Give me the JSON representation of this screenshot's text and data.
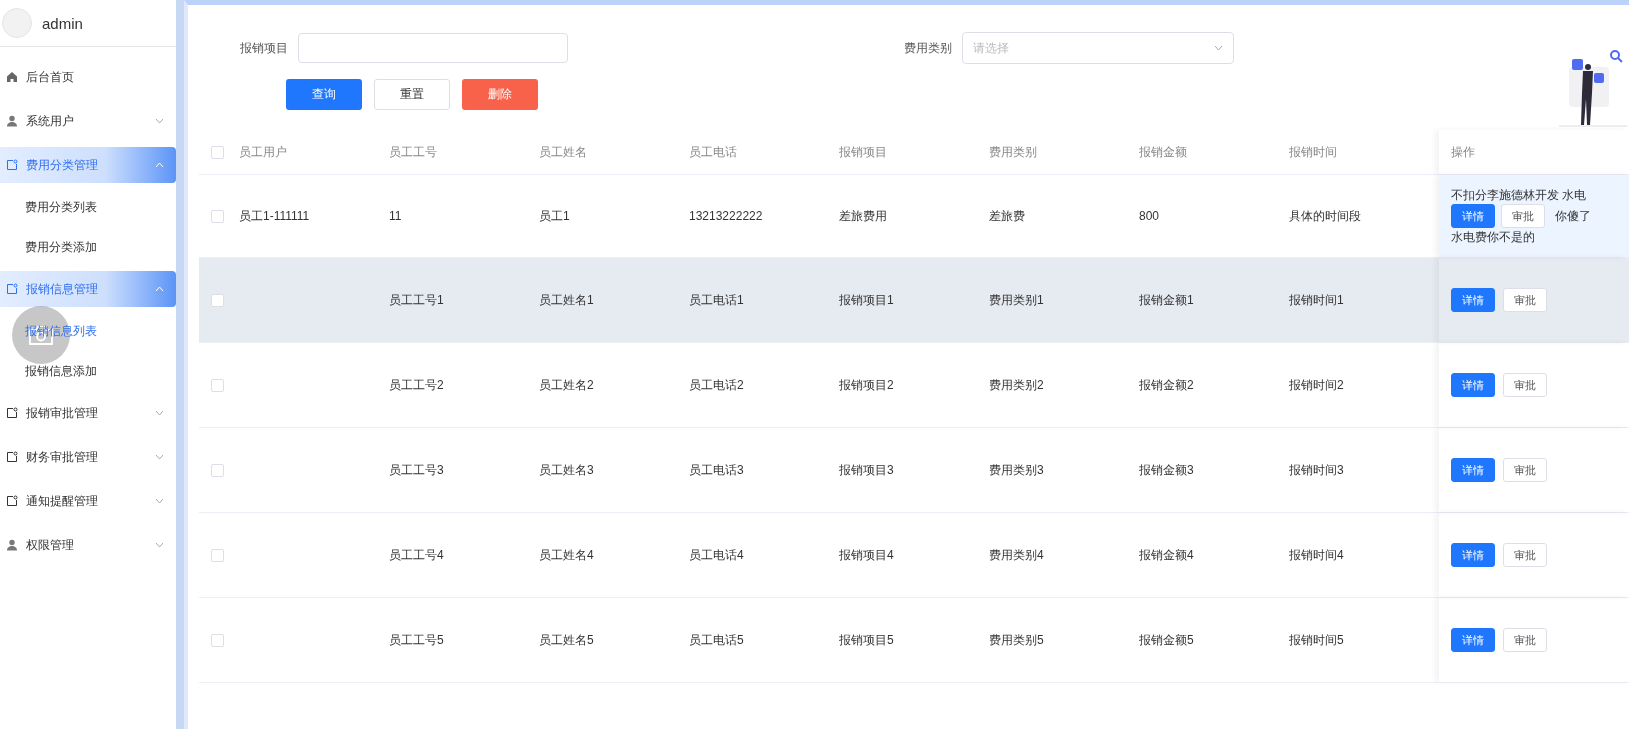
{
  "user": {
    "name": "admin"
  },
  "menu": [
    {
      "label": "后台首页",
      "kind": "home",
      "expanded": false,
      "has_children": false
    },
    {
      "label": "系统用户",
      "kind": "user",
      "expanded": false,
      "has_children": true
    },
    {
      "label": "费用分类管理",
      "kind": "doc",
      "expanded": true,
      "has_children": true,
      "children": [
        {
          "label": "费用分类列表",
          "selected": false
        },
        {
          "label": "费用分类添加",
          "selected": false
        }
      ]
    },
    {
      "label": "报销信息管理",
      "kind": "doc",
      "expanded": true,
      "has_children": true,
      "children": [
        {
          "label": "报销信息列表",
          "selected": true
        },
        {
          "label": "报销信息添加",
          "selected": false
        }
      ]
    },
    {
      "label": "报销审批管理",
      "kind": "doc",
      "expanded": false,
      "has_children": true
    },
    {
      "label": "财务审批管理",
      "kind": "doc",
      "expanded": false,
      "has_children": true
    },
    {
      "label": "通知提醒管理",
      "kind": "doc",
      "expanded": false,
      "has_children": true
    },
    {
      "label": "权限管理",
      "kind": "user",
      "expanded": false,
      "has_children": true
    }
  ],
  "filters": {
    "item_label": "报销项目",
    "category_label": "费用类别",
    "category_placeholder": "请选择"
  },
  "buttons": [
    {
      "label": "查询",
      "kind": "primary"
    },
    {
      "label": "重置",
      "kind": "plain"
    },
    {
      "label": "删除",
      "kind": "danger"
    }
  ],
  "table": {
    "all_checked": false,
    "columns": [
      "员工用户",
      "员工工号",
      "员工姓名",
      "员工电话",
      "报销项目",
      "费用类别",
      "报销金额",
      "报销时间",
      "操作"
    ],
    "rows": [
      {
        "cells": [
          "员工1-111111",
          "11",
          "员工1",
          "13213222222",
          "差旅费用",
          "差旅费",
          "800",
          "具体的时间段"
        ],
        "checked": false,
        "hovered": false,
        "note": [
          "不扣分李施德林开发 水电",
          "你傻了",
          "水电费你不是的"
        ],
        "actions": [
          "详情",
          "审批"
        ]
      },
      {
        "cells": [
          "",
          "员工工号1",
          "员工姓名1",
          "员工电话1",
          "报销项目1",
          "费用类别1",
          "报销金额1",
          "报销时间1"
        ],
        "checked": false,
        "hovered": true,
        "actions": [
          "详情",
          "审批"
        ]
      },
      {
        "cells": [
          "",
          "员工工号2",
          "员工姓名2",
          "员工电话2",
          "报销项目2",
          "费用类别2",
          "报销金额2",
          "报销时间2"
        ],
        "checked": false,
        "hovered": false,
        "actions": [
          "详情",
          "审批"
        ]
      },
      {
        "cells": [
          "",
          "员工工号3",
          "员工姓名3",
          "员工电话3",
          "报销项目3",
          "费用类别3",
          "报销金额3",
          "报销时间3"
        ],
        "checked": false,
        "hovered": false,
        "actions": [
          "详情",
          "审批"
        ]
      },
      {
        "cells": [
          "",
          "员工工号4",
          "员工姓名4",
          "员工电话4",
          "报销项目4",
          "费用类别4",
          "报销金额4",
          "报销时间4"
        ],
        "checked": false,
        "hovered": false,
        "actions": [
          "详情",
          "审批"
        ]
      },
      {
        "cells": [
          "",
          "员工工号5",
          "员工姓名5",
          "员工电话5",
          "报销项目5",
          "费用类别5",
          "报销金额5",
          "报销时间5"
        ],
        "checked": false,
        "hovered": false,
        "actions": [
          "详情",
          "审批"
        ]
      }
    ]
  }
}
